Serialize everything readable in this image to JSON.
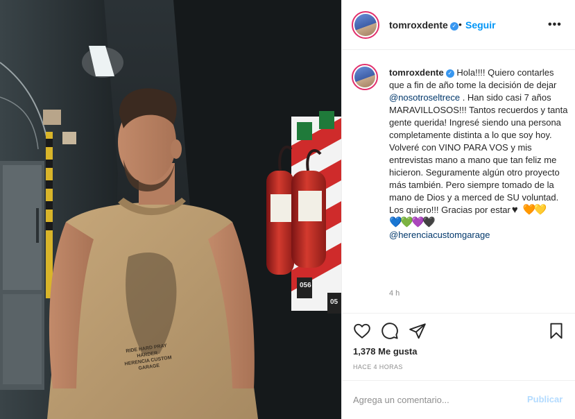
{
  "post": {
    "username": "tomroxdente",
    "follow_label": "Seguir",
    "separator": "•",
    "more_label": "•••"
  },
  "caption": {
    "greeting": " Hola!!!! Quiero contarles que a fin de año tome la decisión de dejar ",
    "mention_1": "@nosotroseltrece",
    "body": " . Han sido casi 7 años MARAVILLOSOS!!! Tantos recuerdos y tanta gente querida! Ingresé siendo una persona completamente distinta a lo que soy hoy. Volveré con VINO PARA VOS y mis entrevistas mano a mano que tan feliz me hicieron. Seguramente algún otro proyecto más también. Pero siempre tomado de la mano de Dios y a merced de SU voluntad.",
    "closing": "Los quiero!!! Gracias por estar",
    "hearts_line1": [
      "♥",
      "🧡",
      "💛"
    ],
    "hearts_line2": [
      "💙",
      "💚",
      "💜",
      "🖤"
    ],
    "mention_2": "@herenciacustomgarage",
    "time_ago": "4 h"
  },
  "actions": {
    "icons": [
      "heart-outline-icon",
      "comment-icon",
      "share-icon",
      "bookmark-icon"
    ]
  },
  "likes": {
    "text": "1,378 Me gusta"
  },
  "posted": {
    "text": "HACE 4 HORAS"
  },
  "comment": {
    "placeholder": "Agrega un comentario...",
    "publish_label": "Publicar"
  },
  "photo": {
    "shirt_print_line1": "RIDE HARD PRAY HARDER",
    "shirt_print_line2": "HERENCIA CUSTOM",
    "shirt_print_line3": "GARAGE",
    "tag_1": "056",
    "tag_2": "05"
  },
  "colors": {
    "accent": "#0095f6",
    "link": "#00376b",
    "verified": "#3897f0",
    "muted": "#8e8e8e",
    "publish_disabled": "#b3dbff"
  }
}
